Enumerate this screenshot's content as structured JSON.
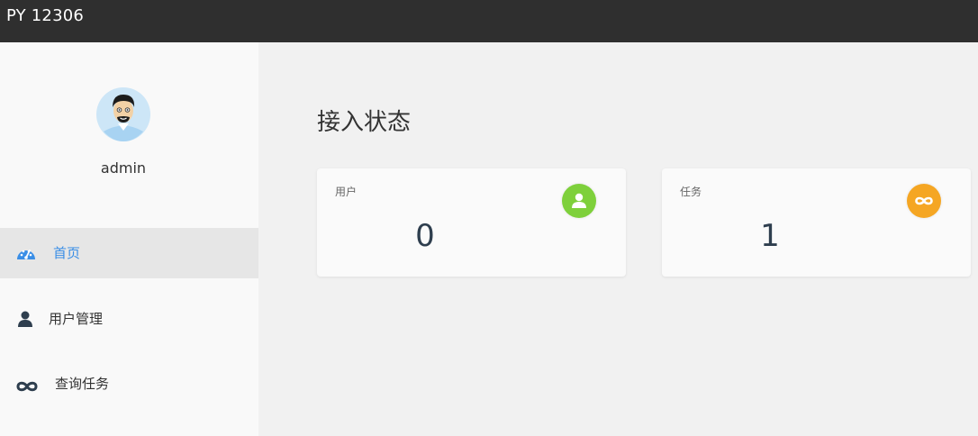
{
  "app": {
    "title": "PY 12306"
  },
  "user": {
    "name": "admin"
  },
  "sidebar": {
    "items": [
      {
        "label": "首页",
        "icon": "dashboard-icon",
        "active": true
      },
      {
        "label": "用户管理",
        "icon": "user-icon",
        "active": false
      },
      {
        "label": "查询任务",
        "icon": "infinity-icon",
        "active": false
      }
    ]
  },
  "main": {
    "title": "接入状态",
    "cards": [
      {
        "label": "用户",
        "value": "0",
        "icon": "user-icon",
        "color": "#7ed03b"
      },
      {
        "label": "任务",
        "value": "1",
        "icon": "infinity-icon",
        "color": "#f5a623"
      }
    ]
  },
  "colors": {
    "topbar": "#2f2f2f",
    "accent": "#3a8ee6",
    "nav_icon": "#2e3e4e"
  }
}
